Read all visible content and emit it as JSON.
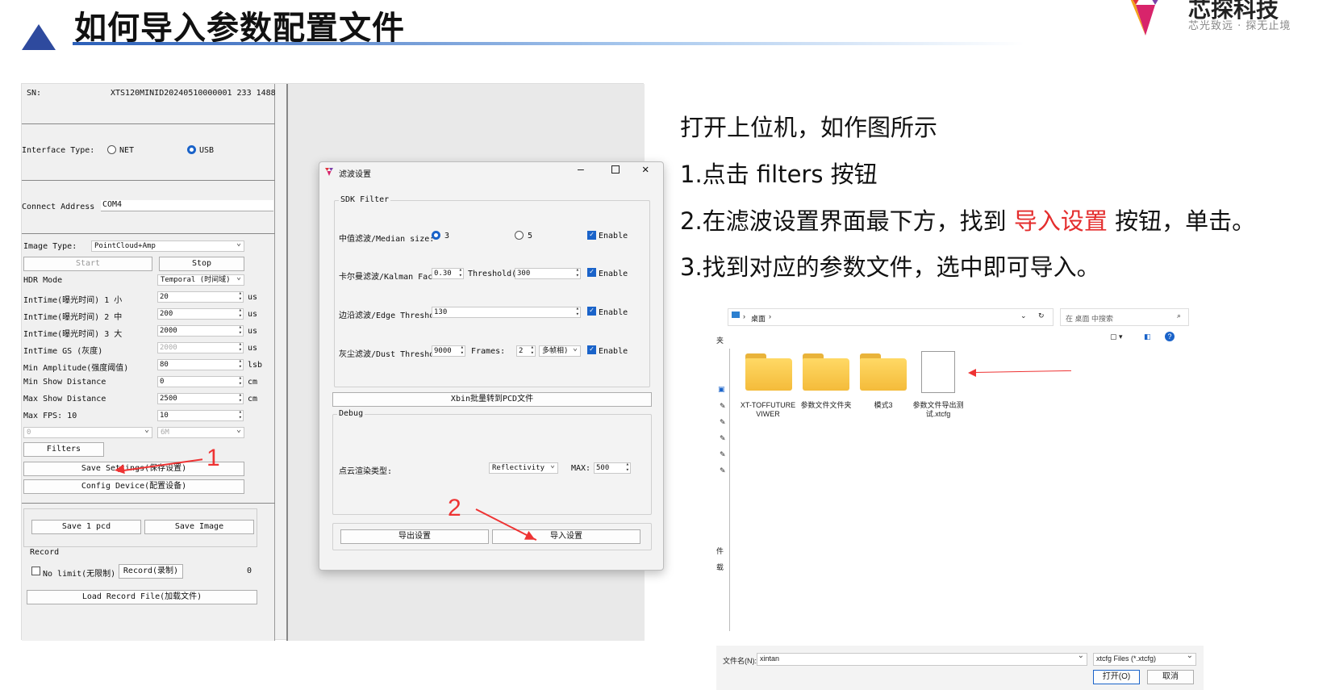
{
  "slide": {
    "title": "如何导入参数配置文件",
    "logo_name": "芯探科技",
    "logo_slogan": "芯光致远 · 探无止境"
  },
  "device_panel": {
    "sn_label": "SN:",
    "sn_value": "XTS120MINID20240510000001 233 1488",
    "interface_label": "Interface Type:",
    "interface_options": [
      "NET",
      "USB"
    ],
    "interface_selected": "USB",
    "connect_label": "Connect Address :",
    "connect_value": "COM4",
    "image_type_label": "Image Type:",
    "image_type_value": "PointCloud+Amp",
    "start_label": "Start",
    "stop_label": "Stop",
    "hdr_label": "HDR Mode",
    "hdr_value": "Temporal (时间域)",
    "params": [
      {
        "label": "IntTime(曝光时间) 1 小",
        "value": "20",
        "unit": "us"
      },
      {
        "label": "IntTime(曝光时间) 2 中",
        "value": "200",
        "unit": "us"
      },
      {
        "label": "IntTime(曝光时间) 3 大",
        "value": "2000",
        "unit": "us"
      },
      {
        "label": "IntTime GS (灰度)",
        "value": "2000",
        "unit": "us"
      },
      {
        "label": "Min Amplitude(强度阈值)",
        "value": "80",
        "unit": "lsb"
      },
      {
        "label": "Min Show Distance",
        "value": "0",
        "unit": "cm"
      },
      {
        "label": "Max Show Distance",
        "value": "2500",
        "unit": "cm"
      },
      {
        "label": "Max FPS: 10",
        "value": "10",
        "unit": ""
      }
    ],
    "combo_a": "0",
    "combo_b": "6M",
    "filters_label": "Filters",
    "save_settings_label": "Save Settings(保存设置)",
    "config_device_label": "Config Device(配置设备)",
    "save_pcd_label": "Save 1 pcd",
    "save_image_label": "Save Image",
    "record_group_label": "Record",
    "no_limit_label": "No limit(无限制)",
    "record_label": "Record(录制)",
    "record_count": "0",
    "load_record_label": "Load Record File(加载文件)"
  },
  "filter_dialog": {
    "title": "滤波设置",
    "sdk_group": "SDK Filter",
    "median_label": "中值滤波/Median size:",
    "median_options": [
      "3",
      "5"
    ],
    "median_selected": "3",
    "kalman_label": "卡尔曼滤波/Kalman Fac",
    "kalman_value": "0.30",
    "threshold_label": "Threshold(",
    "threshold_value": "300",
    "edge_label": "边沿滤波/Edge Thresho",
    "edge_value": "130",
    "dust_label": "灰尘滤波/Dust Thresho",
    "dust_value": "9000",
    "frames_label": "Frames:",
    "frames_value": "2",
    "frames_mode": "多帧相)",
    "enable_label": "Enable",
    "xbin_label": "Xbin批量转到PCD文件",
    "debug_group": "Debug",
    "render_type_label": "点云渲染类型:",
    "render_type_value": "Reflectivity",
    "max_label": "MAX:",
    "max_value": "500",
    "export_label": "导出设置",
    "import_label": "导入设置"
  },
  "instructions": {
    "line0": "打开上位机，如作图所示",
    "line1": "1.点击 filters 按钮",
    "line2_pre": "2.在滤波设置界面最下方，找到 ",
    "line2_highlight": "导入设置",
    "line2_post": " 按钮，单击。",
    "line3": "3.找到对应的参数文件，选中即可导入。",
    "highlight_color": "#e42d2d"
  },
  "annotations": {
    "marker1": "1",
    "marker2": "2"
  },
  "file_dialog": {
    "path": "桌面",
    "search_placeholder": "在 桌面 中搜索",
    "side_label": "夹",
    "items": [
      {
        "name": "XT-TOFFUTURE VIWER",
        "type": "folder"
      },
      {
        "name": "参数文件文件夹",
        "type": "folder"
      },
      {
        "name": "模式3",
        "type": "folder"
      },
      {
        "name": "参数文件导出测试.xtcfg",
        "type": "file"
      }
    ],
    "side_cut_labels": [
      "件",
      "载"
    ],
    "filename_label": "文件名(N):",
    "filename_value": "xintan",
    "filter_value": "xtcfg Files (*.xtcfg)",
    "open_label": "打开(O)",
    "cancel_label": "取消"
  }
}
